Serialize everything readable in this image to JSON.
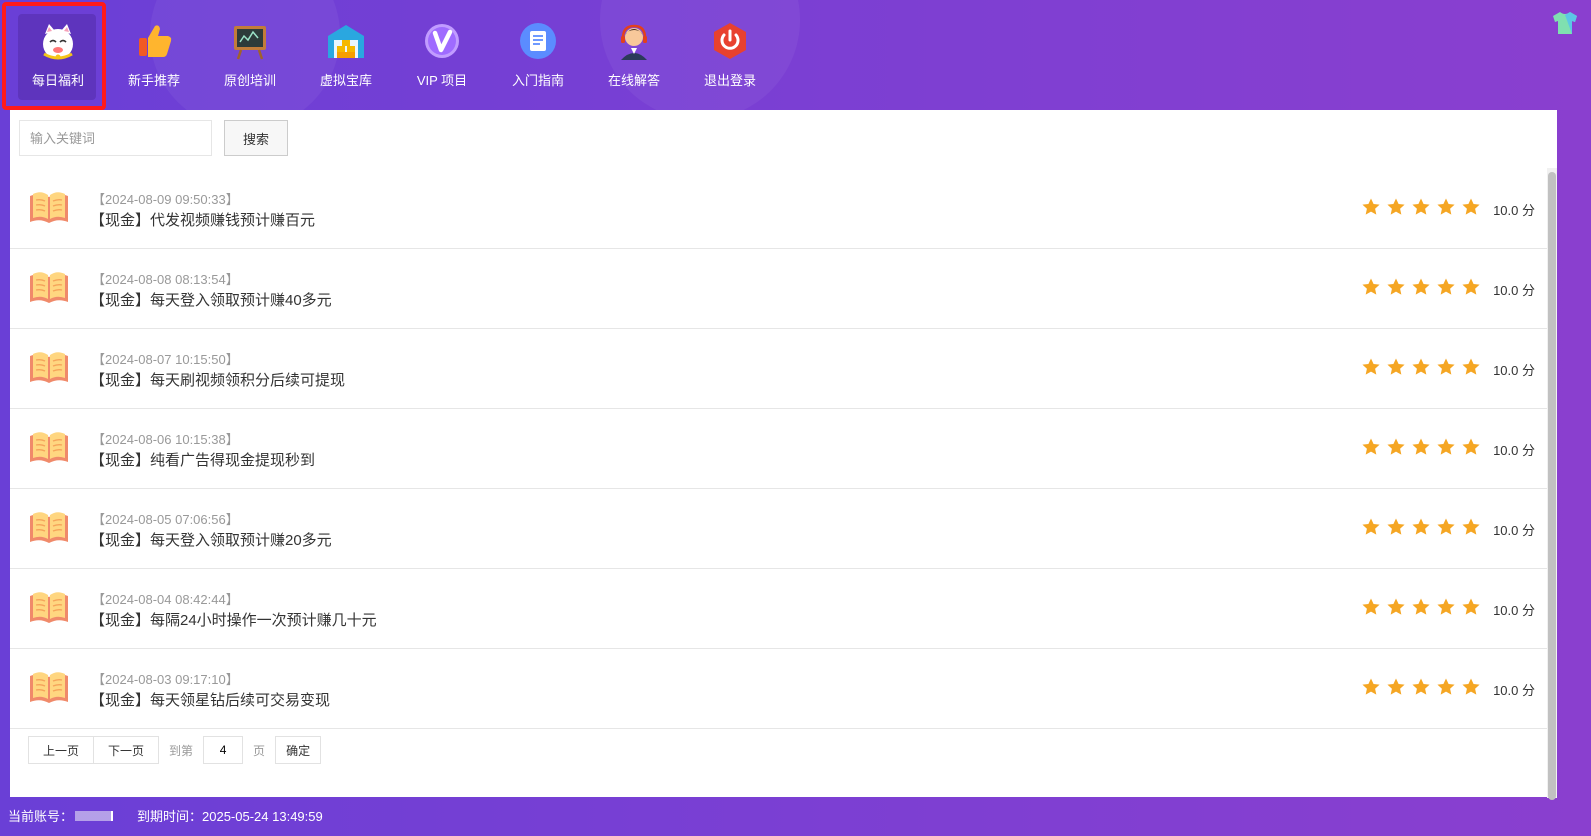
{
  "nav": {
    "items": [
      {
        "label": "每日福利",
        "icon": "lucky-cat-icon",
        "active": true
      },
      {
        "label": "新手推荐",
        "icon": "thumbs-up-icon",
        "active": false
      },
      {
        "label": "原创培训",
        "icon": "chalkboard-icon",
        "active": false
      },
      {
        "label": "虚拟宝库",
        "icon": "warehouse-icon",
        "active": false
      },
      {
        "label": "VIP 项目",
        "icon": "vip-icon",
        "active": false
      },
      {
        "label": "入门指南",
        "icon": "guide-document-icon",
        "active": false
      },
      {
        "label": "在线解答",
        "icon": "support-agent-icon",
        "active": false
      },
      {
        "label": "退出登录",
        "icon": "power-icon",
        "active": false
      }
    ],
    "theme_icon": "tshirt-icon"
  },
  "search": {
    "placeholder": "输入关键词",
    "button_label": "搜索"
  },
  "articles": [
    {
      "date": "【2024-08-09 09:50:33】",
      "title": "【现金】代发视频赚钱预计赚百元",
      "rating_stars": 5,
      "score": "10.0 分"
    },
    {
      "date": "【2024-08-08 08:13:54】",
      "title": "【现金】每天登入领取预计赚40多元",
      "rating_stars": 5,
      "score": "10.0 分"
    },
    {
      "date": "【2024-08-07 10:15:50】",
      "title": "【现金】每天刷视频领积分后续可提现",
      "rating_stars": 5,
      "score": "10.0 分"
    },
    {
      "date": "【2024-08-06 10:15:38】",
      "title": "【现金】纯看广告得现金提现秒到",
      "rating_stars": 5,
      "score": "10.0 分"
    },
    {
      "date": "【2024-08-05 07:06:56】",
      "title": "【现金】每天登入领取预计赚20多元",
      "rating_stars": 5,
      "score": "10.0 分"
    },
    {
      "date": "【2024-08-04 08:42:44】",
      "title": "【现金】每隔24小时操作一次预计赚几十元",
      "rating_stars": 5,
      "score": "10.0 分"
    },
    {
      "date": "【2024-08-03 09:17:10】",
      "title": "【现金】每天领星钻后续可交易变现",
      "rating_stars": 5,
      "score": "10.0 分"
    }
  ],
  "pager": {
    "prev_label": "上一页",
    "next_label": "下一页",
    "goto_label": "到第",
    "page_value": "4",
    "page_unit": "页",
    "confirm_label": "确定"
  },
  "footer": {
    "account_label": "当前账号：",
    "expiry_label": "到期时间：2025-05-24 13:49:59"
  },
  "colors": {
    "star": "#f5a623",
    "highlight_border": "#ff1a1a",
    "header_gradient_start": "#6a3fd6",
    "header_gradient_end": "#8a3fcf"
  }
}
